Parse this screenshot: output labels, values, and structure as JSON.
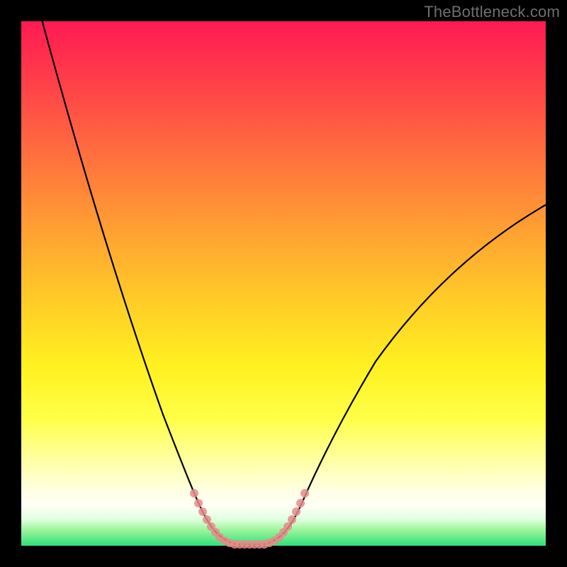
{
  "watermark": "TheBottleneck.com",
  "chart_data": {
    "type": "line",
    "title": "",
    "xlabel": "",
    "ylabel": "",
    "xlim": [
      0,
      100
    ],
    "ylim": [
      0,
      100
    ],
    "grid": false,
    "legend": false,
    "series": [
      {
        "name": "bottleneck-curve",
        "color": "#000000",
        "x": [
          4,
          8,
          12,
          16,
          20,
          24,
          28,
          32,
          33.5,
          36,
          38,
          40,
          42,
          44,
          46,
          48,
          50,
          54,
          58,
          62,
          66,
          70,
          74,
          78,
          82,
          86,
          90,
          94,
          98,
          100
        ],
        "y": [
          100,
          88,
          76,
          64,
          53,
          42,
          32,
          14,
          9,
          3,
          1,
          0,
          0,
          0,
          0,
          1,
          3,
          11,
          18,
          24,
          30,
          35,
          40,
          45,
          49,
          53,
          57,
          60,
          63,
          65
        ]
      },
      {
        "name": "highlight-dots",
        "color": "#e88a8a",
        "type": "scatter",
        "x": [
          32.5,
          33.2,
          34.0,
          34.8,
          35.6,
          36.4,
          37.2,
          38.0,
          38.8,
          39.6,
          40.4,
          41.2,
          42.0,
          42.8,
          43.6,
          44.4,
          45.2,
          46.0,
          46.8,
          47.6,
          48.4,
          49.2,
          50.0,
          50.8,
          51.6
        ],
        "y": [
          12.0,
          9.5,
          7.2,
          5.2,
          3.6,
          2.4,
          1.5,
          0.9,
          0.5,
          0.3,
          0.2,
          0.2,
          0.2,
          0.2,
          0.2,
          0.3,
          0.5,
          0.9,
          1.5,
          2.4,
          3.6,
          5.2,
          7.2,
          9.5,
          12.0
        ]
      }
    ],
    "gradient_stops": [
      {
        "pos": 0.0,
        "color": "#ff1a54"
      },
      {
        "pos": 0.1,
        "color": "#ff3a4a"
      },
      {
        "pos": 0.24,
        "color": "#ff6a3f"
      },
      {
        "pos": 0.38,
        "color": "#ff9a34"
      },
      {
        "pos": 0.52,
        "color": "#ffc828"
      },
      {
        "pos": 0.66,
        "color": "#fff120"
      },
      {
        "pos": 0.76,
        "color": "#ffff4a"
      },
      {
        "pos": 0.82,
        "color": "#ffff90"
      },
      {
        "pos": 0.87,
        "color": "#ffffc8"
      },
      {
        "pos": 0.9,
        "color": "#ffffe8"
      },
      {
        "pos": 0.925,
        "color": "#fffff6"
      },
      {
        "pos": 0.95,
        "color": "#dfffdf"
      },
      {
        "pos": 0.97,
        "color": "#9cf59c"
      },
      {
        "pos": 1.0,
        "color": "#2fe07a"
      }
    ]
  }
}
